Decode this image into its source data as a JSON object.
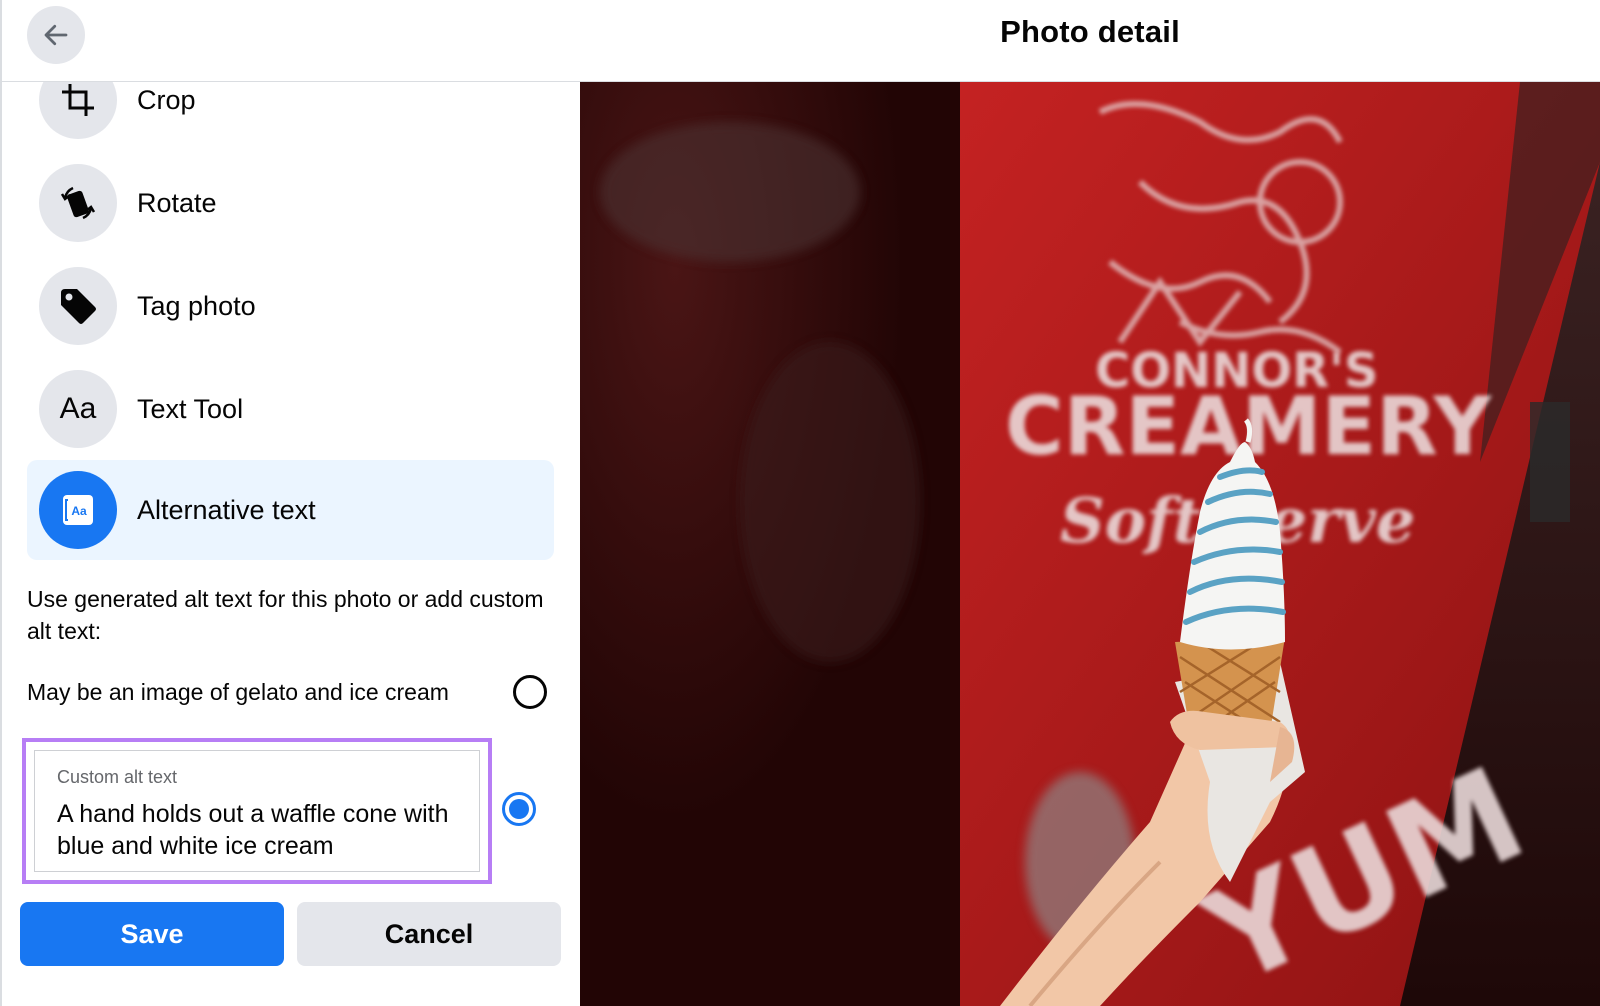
{
  "header": {
    "title": "Photo detail"
  },
  "tools": [
    {
      "label": "Crop",
      "icon": "crop-icon"
    },
    {
      "label": "Rotate",
      "icon": "rotate-icon"
    },
    {
      "label": "Tag photo",
      "icon": "tag-icon"
    },
    {
      "label": "Text Tool",
      "icon": "text-tool-icon",
      "glyph": "Aa"
    },
    {
      "label": "Alternative text",
      "icon": "alt-text-icon",
      "glyph": "Aa",
      "active": true
    }
  ],
  "alt_text": {
    "description": "Use generated alt text for this photo or add custom alt text:",
    "generated_option": "May be an image of gelato and ice cream",
    "generated_selected": false,
    "custom_label": "Custom alt text",
    "custom_value": "A hand holds out a waffle cone with blue and white ice cream",
    "custom_selected": true
  },
  "buttons": {
    "save": "Save",
    "cancel": "Cancel"
  },
  "photo": {
    "sign_line1": "CONNOR'S",
    "sign_line2": "CREAMERY",
    "sign_line3": "Soft Serve",
    "sign_yum": "YUM"
  },
  "colors": {
    "accent": "#1877f2",
    "highlight_border": "#b77ef5",
    "active_bg": "#ebf5ff",
    "sign_red": "#b41d1d"
  }
}
